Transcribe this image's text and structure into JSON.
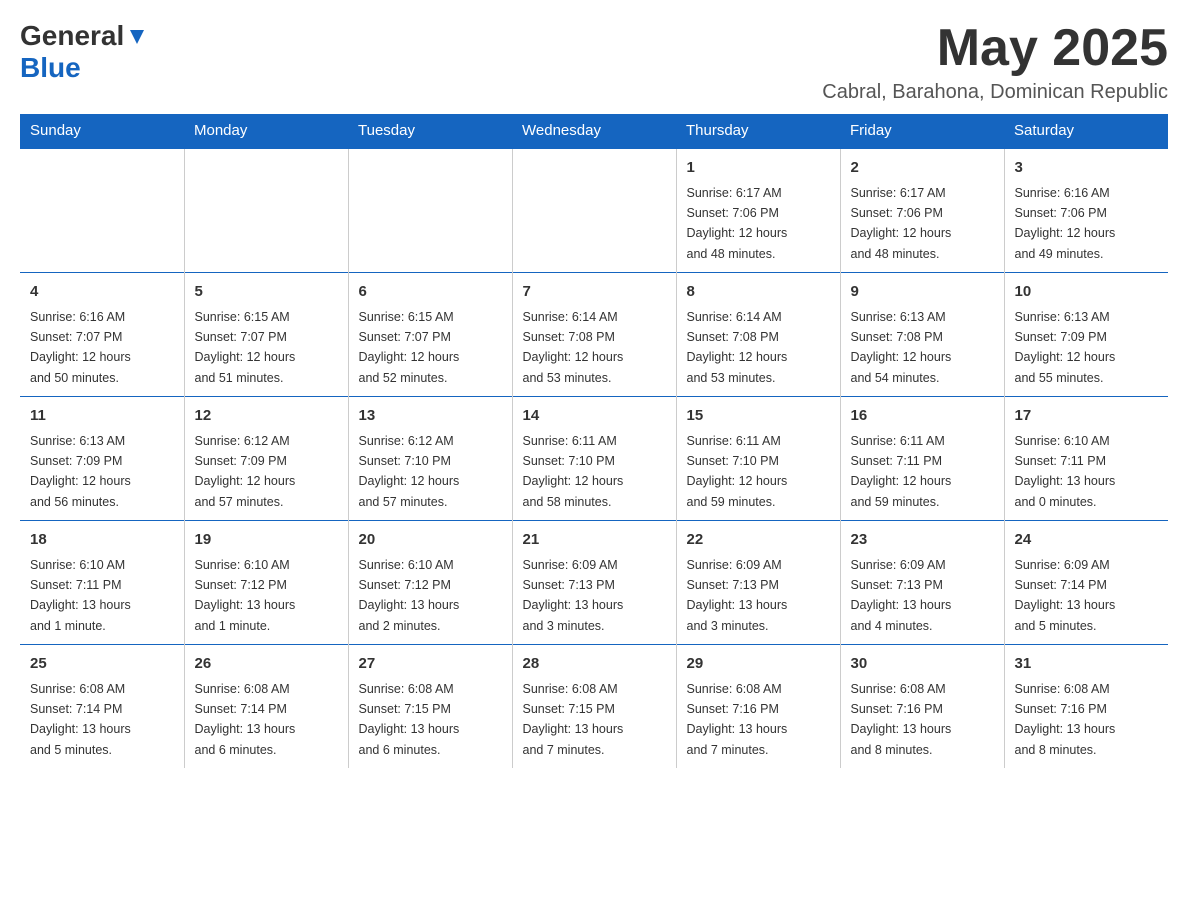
{
  "header": {
    "logo_general": "General",
    "logo_blue": "Blue",
    "month_title": "May 2025",
    "location": "Cabral, Barahona, Dominican Republic"
  },
  "weekdays": [
    "Sunday",
    "Monday",
    "Tuesday",
    "Wednesday",
    "Thursday",
    "Friday",
    "Saturday"
  ],
  "weeks": [
    [
      {
        "day": "",
        "info": ""
      },
      {
        "day": "",
        "info": ""
      },
      {
        "day": "",
        "info": ""
      },
      {
        "day": "",
        "info": ""
      },
      {
        "day": "1",
        "info": "Sunrise: 6:17 AM\nSunset: 7:06 PM\nDaylight: 12 hours\nand 48 minutes."
      },
      {
        "day": "2",
        "info": "Sunrise: 6:17 AM\nSunset: 7:06 PM\nDaylight: 12 hours\nand 48 minutes."
      },
      {
        "day": "3",
        "info": "Sunrise: 6:16 AM\nSunset: 7:06 PM\nDaylight: 12 hours\nand 49 minutes."
      }
    ],
    [
      {
        "day": "4",
        "info": "Sunrise: 6:16 AM\nSunset: 7:07 PM\nDaylight: 12 hours\nand 50 minutes."
      },
      {
        "day": "5",
        "info": "Sunrise: 6:15 AM\nSunset: 7:07 PM\nDaylight: 12 hours\nand 51 minutes."
      },
      {
        "day": "6",
        "info": "Sunrise: 6:15 AM\nSunset: 7:07 PM\nDaylight: 12 hours\nand 52 minutes."
      },
      {
        "day": "7",
        "info": "Sunrise: 6:14 AM\nSunset: 7:08 PM\nDaylight: 12 hours\nand 53 minutes."
      },
      {
        "day": "8",
        "info": "Sunrise: 6:14 AM\nSunset: 7:08 PM\nDaylight: 12 hours\nand 53 minutes."
      },
      {
        "day": "9",
        "info": "Sunrise: 6:13 AM\nSunset: 7:08 PM\nDaylight: 12 hours\nand 54 minutes."
      },
      {
        "day": "10",
        "info": "Sunrise: 6:13 AM\nSunset: 7:09 PM\nDaylight: 12 hours\nand 55 minutes."
      }
    ],
    [
      {
        "day": "11",
        "info": "Sunrise: 6:13 AM\nSunset: 7:09 PM\nDaylight: 12 hours\nand 56 minutes."
      },
      {
        "day": "12",
        "info": "Sunrise: 6:12 AM\nSunset: 7:09 PM\nDaylight: 12 hours\nand 57 minutes."
      },
      {
        "day": "13",
        "info": "Sunrise: 6:12 AM\nSunset: 7:10 PM\nDaylight: 12 hours\nand 57 minutes."
      },
      {
        "day": "14",
        "info": "Sunrise: 6:11 AM\nSunset: 7:10 PM\nDaylight: 12 hours\nand 58 minutes."
      },
      {
        "day": "15",
        "info": "Sunrise: 6:11 AM\nSunset: 7:10 PM\nDaylight: 12 hours\nand 59 minutes."
      },
      {
        "day": "16",
        "info": "Sunrise: 6:11 AM\nSunset: 7:11 PM\nDaylight: 12 hours\nand 59 minutes."
      },
      {
        "day": "17",
        "info": "Sunrise: 6:10 AM\nSunset: 7:11 PM\nDaylight: 13 hours\nand 0 minutes."
      }
    ],
    [
      {
        "day": "18",
        "info": "Sunrise: 6:10 AM\nSunset: 7:11 PM\nDaylight: 13 hours\nand 1 minute."
      },
      {
        "day": "19",
        "info": "Sunrise: 6:10 AM\nSunset: 7:12 PM\nDaylight: 13 hours\nand 1 minute."
      },
      {
        "day": "20",
        "info": "Sunrise: 6:10 AM\nSunset: 7:12 PM\nDaylight: 13 hours\nand 2 minutes."
      },
      {
        "day": "21",
        "info": "Sunrise: 6:09 AM\nSunset: 7:13 PM\nDaylight: 13 hours\nand 3 minutes."
      },
      {
        "day": "22",
        "info": "Sunrise: 6:09 AM\nSunset: 7:13 PM\nDaylight: 13 hours\nand 3 minutes."
      },
      {
        "day": "23",
        "info": "Sunrise: 6:09 AM\nSunset: 7:13 PM\nDaylight: 13 hours\nand 4 minutes."
      },
      {
        "day": "24",
        "info": "Sunrise: 6:09 AM\nSunset: 7:14 PM\nDaylight: 13 hours\nand 5 minutes."
      }
    ],
    [
      {
        "day": "25",
        "info": "Sunrise: 6:08 AM\nSunset: 7:14 PM\nDaylight: 13 hours\nand 5 minutes."
      },
      {
        "day": "26",
        "info": "Sunrise: 6:08 AM\nSunset: 7:14 PM\nDaylight: 13 hours\nand 6 minutes."
      },
      {
        "day": "27",
        "info": "Sunrise: 6:08 AM\nSunset: 7:15 PM\nDaylight: 13 hours\nand 6 minutes."
      },
      {
        "day": "28",
        "info": "Sunrise: 6:08 AM\nSunset: 7:15 PM\nDaylight: 13 hours\nand 7 minutes."
      },
      {
        "day": "29",
        "info": "Sunrise: 6:08 AM\nSunset: 7:16 PM\nDaylight: 13 hours\nand 7 minutes."
      },
      {
        "day": "30",
        "info": "Sunrise: 6:08 AM\nSunset: 7:16 PM\nDaylight: 13 hours\nand 8 minutes."
      },
      {
        "day": "31",
        "info": "Sunrise: 6:08 AM\nSunset: 7:16 PM\nDaylight: 13 hours\nand 8 minutes."
      }
    ]
  ]
}
